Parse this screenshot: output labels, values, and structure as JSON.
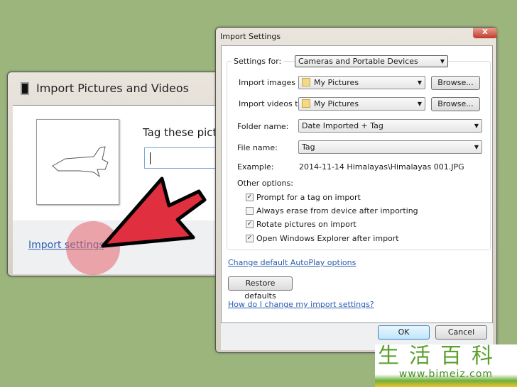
{
  "left_dialog": {
    "title": "Import Pictures and Videos",
    "tag_label": "Tag these pictu",
    "tag_value": "",
    "import_settings_link": "Import settings"
  },
  "import_settings": {
    "title": "Import Settings",
    "close_label": "X",
    "settings_for_label": "Settings for:",
    "settings_for_value": "Cameras and Portable Devices",
    "import_images_label": "Import images to:",
    "import_images_value": "My Pictures",
    "import_videos_label": "Import videos to:",
    "import_videos_value": "My Pictures",
    "browse_label": "Browse...",
    "folder_name_label": "Folder name:",
    "folder_name_value": "Date Imported + Tag",
    "file_name_label": "File name:",
    "file_name_value": "Tag",
    "example_label": "Example:",
    "example_value": "2014-11-14 Himalayas\\Himalayas 001.JPG",
    "other_options_label": "Other options:",
    "options": [
      {
        "label": "Prompt for a tag on import",
        "checked": true
      },
      {
        "label": "Always erase from device after importing",
        "checked": false
      },
      {
        "label": "Rotate pictures on import",
        "checked": true
      },
      {
        "label": "Open Windows Explorer after import",
        "checked": true
      }
    ],
    "autoplay_link": "Change default AutoPlay options",
    "restore_defaults": "Restore defaults",
    "help_link": "How do I change my import settings?",
    "ok": "OK",
    "cancel": "Cancel"
  },
  "watermark": {
    "chars": "生活百科",
    "url": "www.bimeiz.com"
  },
  "colors": {
    "background": "#9bb57d",
    "arrow": "#e0303f",
    "link": "#2a5db0"
  }
}
